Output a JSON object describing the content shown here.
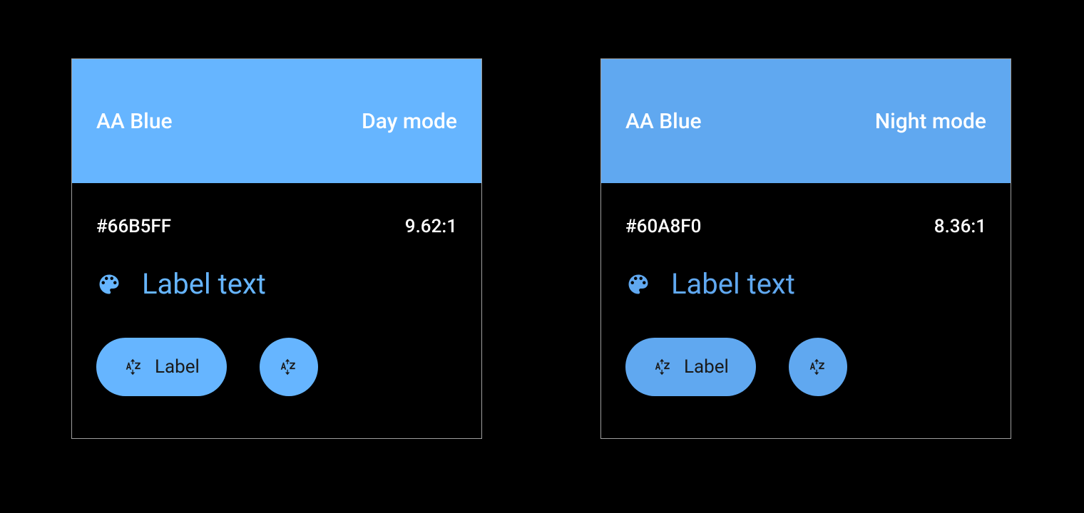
{
  "cards": [
    {
      "title": "AA Blue",
      "mode": "Day mode",
      "swatch": "#66B5FF",
      "hex": "#66B5FF",
      "ratio": "9.62:1",
      "labelText": "Label text",
      "pillLabel": "Label"
    },
    {
      "title": "AA Blue",
      "mode": "Night mode",
      "swatch": "#60A8F0",
      "hex": "#60A8F0",
      "ratio": "8.36:1",
      "labelText": "Label text",
      "pillLabel": "Label"
    }
  ]
}
